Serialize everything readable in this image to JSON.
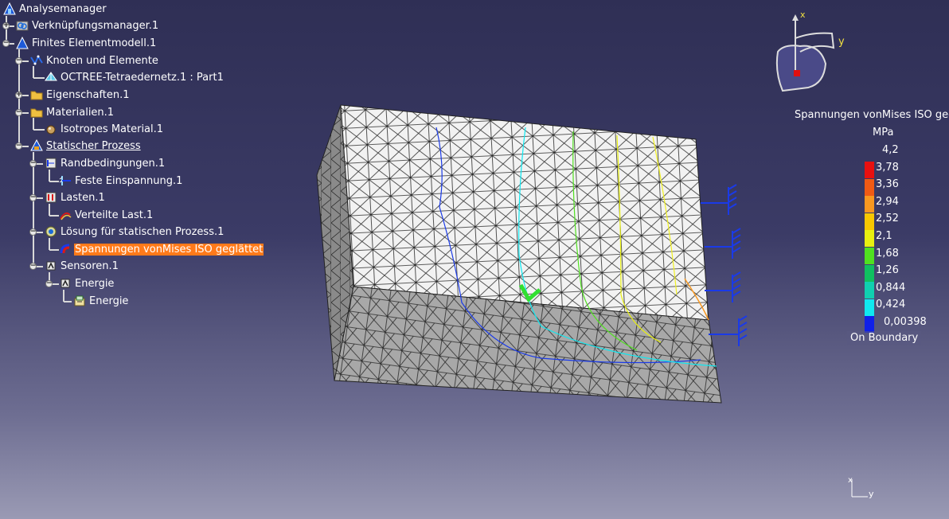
{
  "tree": {
    "items": [
      {
        "label": "Analysemanager",
        "icon": "analysis-manager-icon"
      },
      {
        "label": "Verknüpfungsmanager.1",
        "icon": "link-manager-icon"
      },
      {
        "label": "Finites Elementmodell.1",
        "icon": "fem-model-icon"
      },
      {
        "label": "Knoten und Elemente",
        "icon": "nodes-elements-icon"
      },
      {
        "label": "OCTREE-Tetraedernetz.1 : Part1",
        "icon": "tetra-mesh-icon"
      },
      {
        "label": "Eigenschaften.1",
        "icon": "folder-icon"
      },
      {
        "label": "Materialien.1",
        "icon": "folder-icon"
      },
      {
        "label": "Isotropes Material.1",
        "icon": "material-icon"
      },
      {
        "label": "Statischer Prozess",
        "icon": "static-case-icon"
      },
      {
        "label": "Randbedingungen.1",
        "icon": "restraints-icon"
      },
      {
        "label": "Feste Einspannung.1",
        "icon": "clamp-icon"
      },
      {
        "label": "Lasten.1",
        "icon": "loads-icon"
      },
      {
        "label": "Verteilte Last.1",
        "icon": "distributed-force-icon"
      },
      {
        "label": "Lösung für statischen Prozess.1",
        "icon": "solution-icon"
      },
      {
        "label": "Spannungen vonMises ISO geglättet",
        "icon": "image-icon"
      },
      {
        "label": "Sensoren.1",
        "icon": "sensors-icon"
      },
      {
        "label": "Energie",
        "icon": "sensor-icon"
      },
      {
        "label": "Energie",
        "icon": "energy-icon"
      }
    ]
  },
  "compass": {
    "x_label": "x",
    "y_label": "y"
  },
  "legend": {
    "title": "Spannungen vonMises ISO gegl.",
    "unit": "MPa",
    "values": [
      "4,2",
      "3,78",
      "3,36",
      "2,94",
      "2,52",
      "2,1",
      "1,68",
      "1,26",
      "0,844",
      "0,424",
      "0,00398"
    ],
    "colors": [
      "#e81010",
      "#f05a14",
      "#f89820",
      "#f8c800",
      "#e8f010",
      "#50e020",
      "#10c060",
      "#10d0b0",
      "#10e8f0",
      "#1020e8"
    ],
    "footer": "On Boundary"
  },
  "axis_small": {
    "x_label": "x",
    "y_label": "y"
  }
}
